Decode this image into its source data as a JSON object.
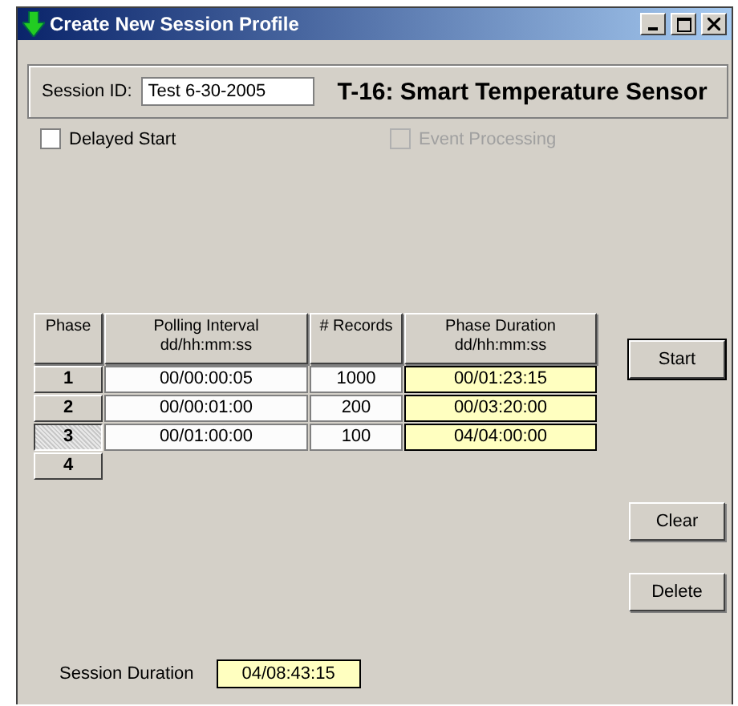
{
  "window": {
    "title": "Create New Session Profile"
  },
  "session_id": {
    "label": "Session ID:",
    "value": "Test 6-30-2005"
  },
  "device_title": "T-16: Smart Temperature Sensor",
  "options": [
    {
      "label": "Delayed Start",
      "checked": false,
      "disabled": false
    },
    {
      "label": "Event Processing",
      "checked": false,
      "disabled": true
    }
  ],
  "table": {
    "columns": [
      "Phase",
      "Polling Interval\ndd/hh:mm:ss",
      "# Records",
      "Phase Duration\ndd/hh:mm:ss"
    ],
    "rows": [
      {
        "phase": "1",
        "selected": false,
        "interval": "00/00:00:05",
        "records": "1000",
        "duration": "00/01:23:15"
      },
      {
        "phase": "2",
        "selected": false,
        "interval": "00/00:01:00",
        "records": "200",
        "duration": "00/03:20:00"
      },
      {
        "phase": "3",
        "selected": true,
        "interval": "00/01:00:00",
        "records": "100",
        "duration": "04/04:00:00"
      },
      {
        "phase": "4",
        "selected": false
      }
    ]
  },
  "buttons": {
    "start": "Start",
    "clear": "Clear",
    "delete": "Delete"
  },
  "session_duration": {
    "label": "Session Duration",
    "value": "04/08:43:15"
  }
}
